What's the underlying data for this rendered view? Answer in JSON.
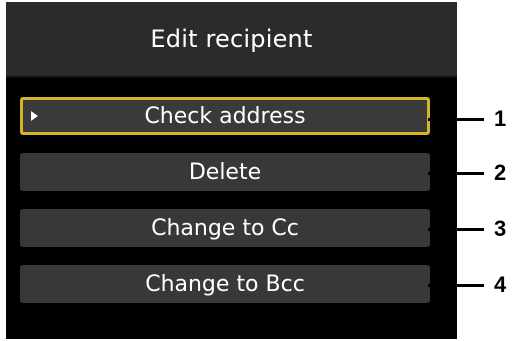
{
  "title": "Edit recipient",
  "menu": [
    {
      "label": "Check address",
      "selected": true
    },
    {
      "label": "Delete",
      "selected": false
    },
    {
      "label": "Change to Cc",
      "selected": false
    },
    {
      "label": "Change to Bcc",
      "selected": false
    }
  ],
  "callouts": [
    "1",
    "2",
    "3",
    "4"
  ],
  "colors": {
    "selection": "#d4b628",
    "button": "#383838",
    "screen": "#000000"
  }
}
